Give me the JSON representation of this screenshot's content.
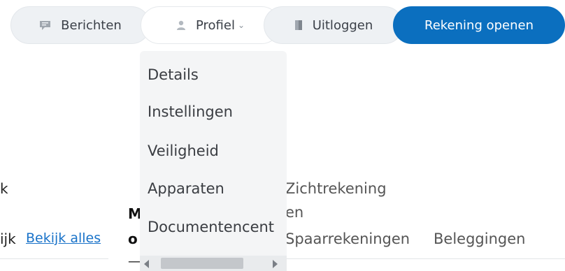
{
  "nav": {
    "berichten_label": "Berichten",
    "profiel_label": "Profiel",
    "uitloggen_label": "Uitloggen",
    "open_label": "Rekening openen",
    "chevron": "⌄"
  },
  "dropdown": {
    "items": [
      {
        "label": "Details"
      },
      {
        "label": "Instellingen"
      },
      {
        "label": "Veiligheid"
      },
      {
        "label": "Apparaten"
      },
      {
        "label": "Documentencent"
      }
    ]
  },
  "background": {
    "k_text": "k",
    "ijk_text": "ijk",
    "bekijk_alles": "Bekijk alles",
    "m_text": "M",
    "o_text": "o",
    "dash_text": "—",
    "zichtrekening": "Zichtrekening",
    "en_text": "en",
    "spaarrekeningen": "Spaarrekeningen",
    "beleggingen": "Beleggingen"
  },
  "colors": {
    "accent": "#0b6fbf",
    "link": "#1a73c9",
    "pill_bg": "#eef1f4",
    "dropdown_bg": "#f4f5f6"
  },
  "icons": {
    "berichten": "message-icon",
    "profiel": "user-icon",
    "uitloggen": "logout-door-icon"
  }
}
